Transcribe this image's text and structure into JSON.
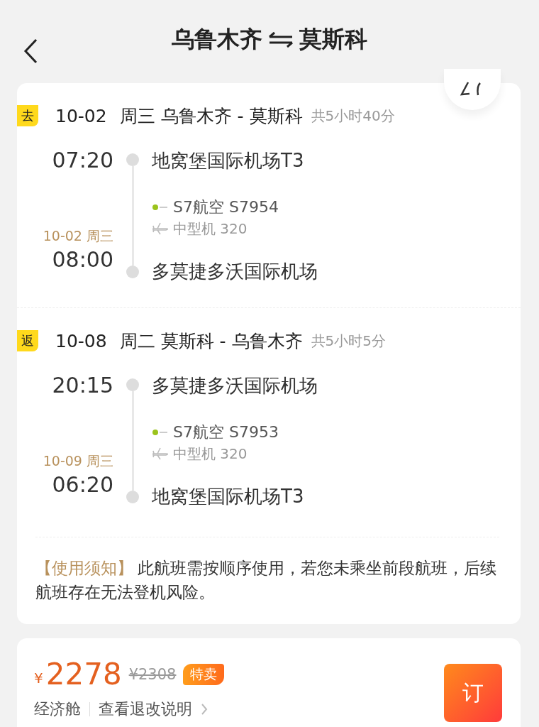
{
  "header": {
    "title_from": "乌鲁木齐",
    "title_to": "莫斯科"
  },
  "legs": [
    {
      "tag": "去",
      "date": "10-02",
      "weekday": "周三",
      "route": "乌鲁木齐 - 莫斯科",
      "duration": "共5小时40分",
      "depart_time": "07:20",
      "depart_airport": "地窝堡国际机场T3",
      "flight": "S7航空 S7954",
      "aircraft": "中型机 320",
      "arrive_date": "10-02 周三",
      "arrive_time": "08:00",
      "arrive_airport": "多莫捷多沃国际机场"
    },
    {
      "tag": "返",
      "date": "10-08",
      "weekday": "周二",
      "route": "莫斯科 - 乌鲁木齐",
      "duration": "共5小时5分",
      "depart_time": "20:15",
      "depart_airport": "多莫捷多沃国际机场",
      "flight": "S7航空 S7953",
      "aircraft": "中型机 320",
      "arrive_date": "10-09 周三",
      "arrive_time": "06:20",
      "arrive_airport": "地窝堡国际机场T3"
    }
  ],
  "notice": {
    "label": "【使用须知】",
    "text": "此航班需按顺序使用，若您未乘坐前段航班，后续航班存在无法登机风险。"
  },
  "fare": {
    "currency": "¥",
    "price": "2278",
    "original_price": "¥2308",
    "badge": "特卖",
    "cabin": "经济舱",
    "rules_link": "查看退改说明",
    "book_button": "订"
  }
}
